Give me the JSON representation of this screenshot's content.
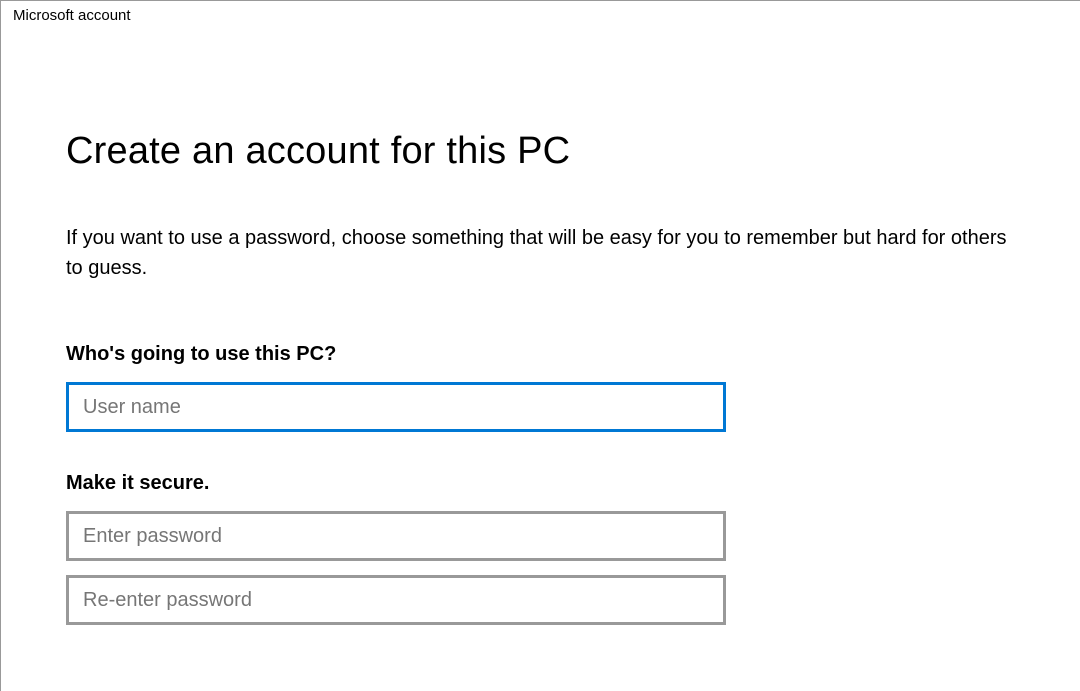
{
  "window": {
    "title": "Microsoft account"
  },
  "page": {
    "heading": "Create an account for this PC",
    "description": "If you want to use a password, choose something that will be easy for you to remember but hard for others to guess."
  },
  "section_user": {
    "label": "Who's going to use this PC?",
    "username_placeholder": "User name",
    "username_value": ""
  },
  "section_secure": {
    "label": "Make it secure.",
    "password_placeholder": "Enter password",
    "password_value": "",
    "confirm_placeholder": "Re-enter password",
    "confirm_value": ""
  }
}
